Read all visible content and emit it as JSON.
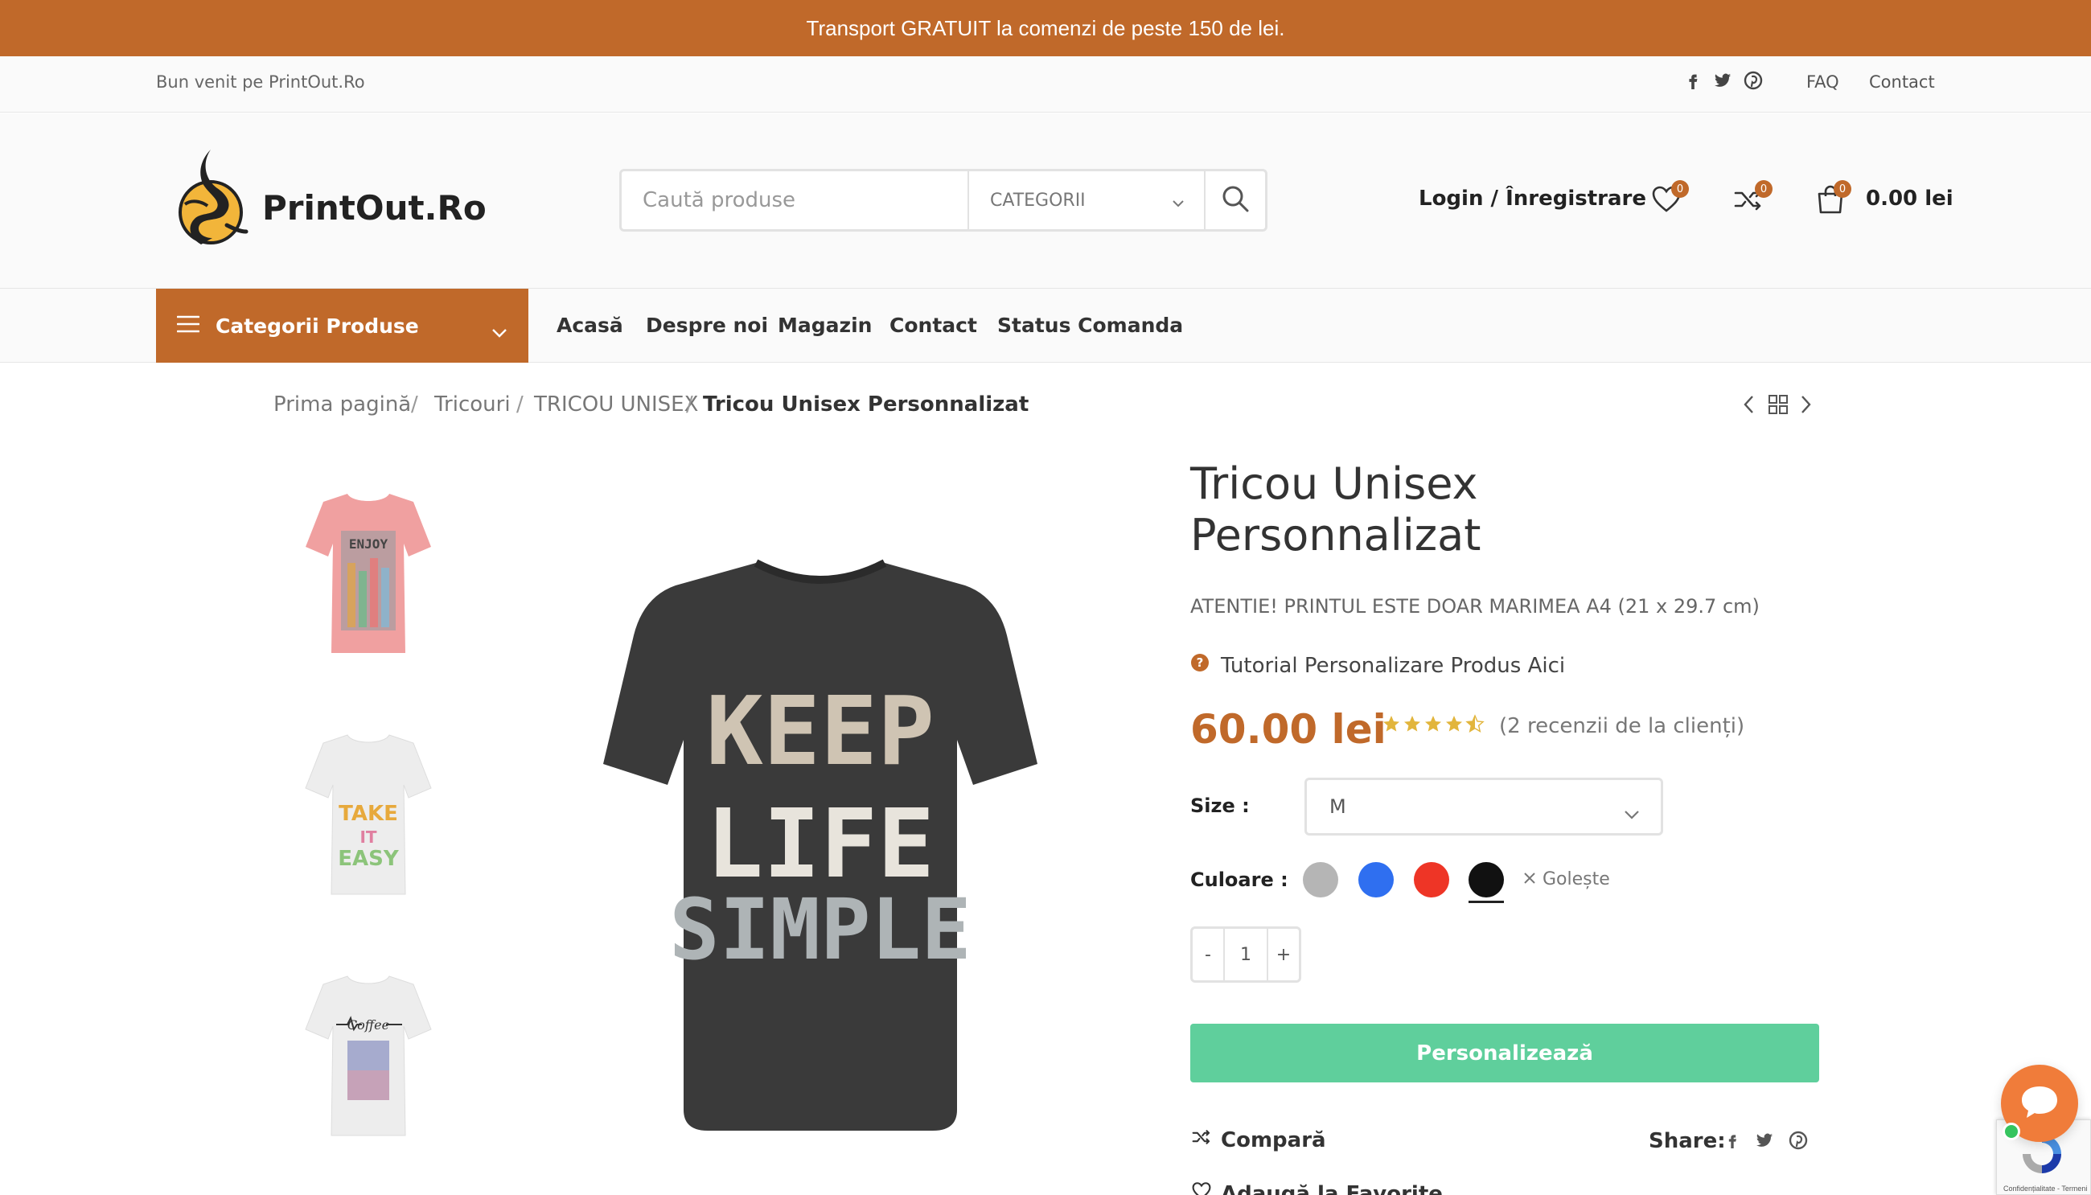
{
  "promo": {
    "text": "Transport GRATUIT la comenzi de peste 150 de lei."
  },
  "topbar": {
    "welcome": "Bun venit pe PrintOut.Ro",
    "social_icons": [
      "facebook-icon",
      "twitter-icon",
      "pinterest-icon"
    ],
    "links": [
      "FAQ",
      "Contact"
    ]
  },
  "header": {
    "logo_text": "PrintOut.Ro",
    "search_placeholder": "Caută produse",
    "category_select": "CATEGORII",
    "login_label": "Login / Înregistrare",
    "wishlist_count": "0",
    "compare_count": "0",
    "cart_count": "0",
    "cart_total": "0.00 lei"
  },
  "nav": {
    "categories_label": "Categorii Produse",
    "items": [
      "Acasă",
      "Despre noi",
      "Magazin",
      "Contact",
      "Status Comanda"
    ]
  },
  "breadcrumb": [
    "Prima pagină",
    "Tricouri",
    "TRICOU UNISEX",
    "Tricou Unisex Personnalizat"
  ],
  "product": {
    "title_line1": "Tricou Unisex",
    "title_line2": "Personnalizat",
    "note": "ATENTIE! PRINTUL ESTE DOAR MARIMEA A4 (21 x 29.7 cm)",
    "tutorial": "Tutorial Personalizare Produs Aici",
    "price": "60.00 lei",
    "rating": 4.5,
    "reviews": "(2 recenzii de la clienți)",
    "size_label": "Size",
    "size_value": "M",
    "color_label": "Culoare",
    "colors": [
      {
        "name": "gray",
        "hex": "#b5b5b5"
      },
      {
        "name": "blue",
        "hex": "#2f6ff0"
      },
      {
        "name": "red",
        "hex": "#ee3526"
      },
      {
        "name": "black",
        "hex": "#111111"
      }
    ],
    "selected_color": "black",
    "clear_label": "Golește",
    "quantity": "1",
    "qty_minus": "-",
    "qty_plus": "+",
    "cta_label": "Personalizează",
    "compare_label": "Compară",
    "share_label": "Share:",
    "favorite_label": "Adaugă la Favorite",
    "main_image_text": [
      "KEEP",
      "LIFE",
      "SIMPLE"
    ],
    "thumbnails": [
      {
        "shirt_color": "#f0a0a0",
        "print_text": "ENJOY"
      },
      {
        "shirt_color": "#f2f2f2",
        "print_text": "TAKE IT EASY"
      },
      {
        "shirt_color": "#f2f2f2",
        "print_text": "Coffee"
      }
    ]
  },
  "recaptcha": {
    "text": "Confidențialitate - Termeni"
  },
  "colors": {
    "accent": "#c0692a",
    "cta": "#5fcf9c",
    "chat": "#f07c3a"
  }
}
